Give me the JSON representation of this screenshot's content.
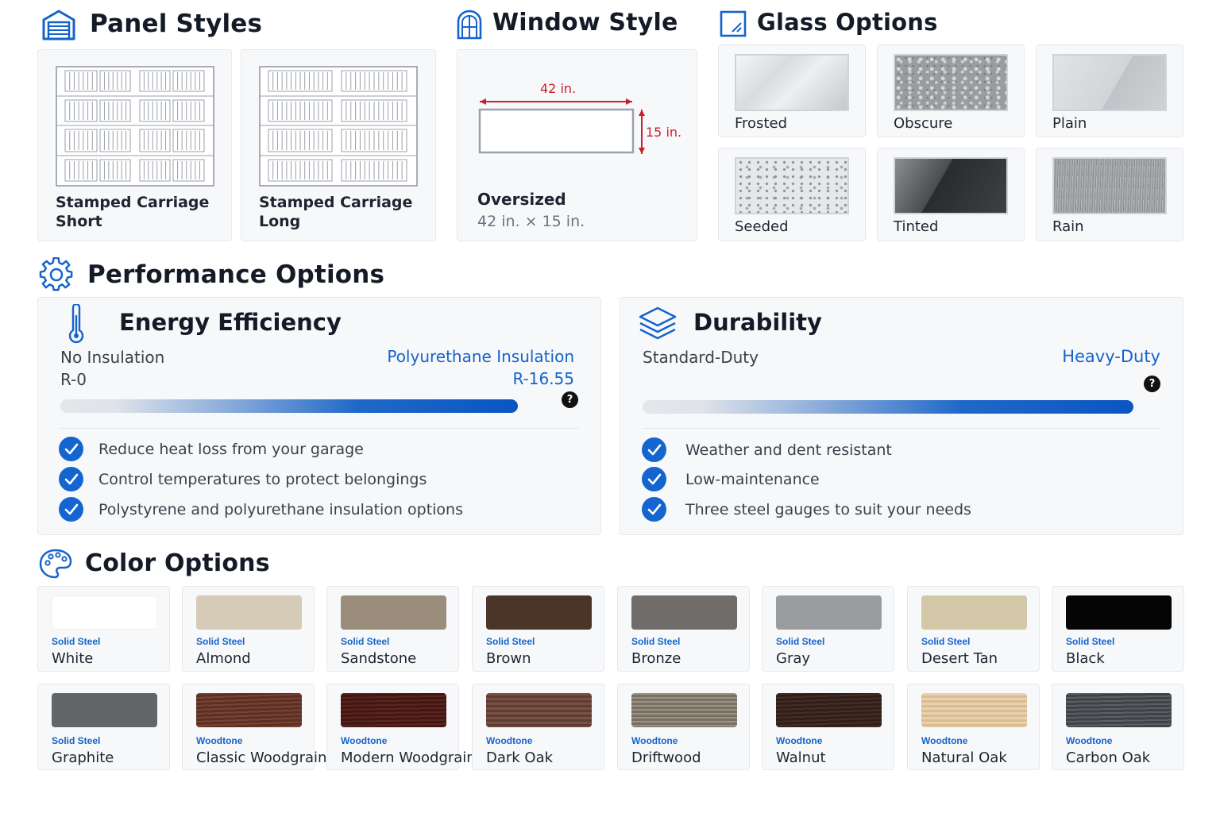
{
  "panel_styles": {
    "title": "Panel Styles",
    "items": [
      {
        "line1": "Stamped Carriage",
        "line2": "Short"
      },
      {
        "line1": "Stamped Carriage",
        "line2": "Long"
      }
    ]
  },
  "window_style": {
    "title": "Window Style",
    "width_dim": "42 in.",
    "height_dim": "15 in.",
    "name": "Oversized",
    "size": "42 in. × 15 in."
  },
  "glass_options": {
    "title": "Glass Options",
    "items": [
      {
        "label": "Frosted"
      },
      {
        "label": "Obscure"
      },
      {
        "label": "Plain"
      },
      {
        "label": "Seeded"
      },
      {
        "label": "Tinted"
      },
      {
        "label": "Rain"
      }
    ]
  },
  "performance": {
    "title": "Performance Options",
    "energy": {
      "title": "Energy Efficiency",
      "left_label": "No Insulation",
      "left_value": "R-0",
      "right_label": "Polyurethane Insulation",
      "right_value": "R-16.55",
      "help": "?",
      "features": [
        "Reduce heat loss from your garage",
        "Control temperatures to protect belongings",
        "Polystyrene and polyurethane insulation options"
      ]
    },
    "durability": {
      "title": "Durability",
      "left_label": "Standard-Duty",
      "right_label": "Heavy-Duty",
      "help": "?",
      "features": [
        "Weather and dent resistant",
        "Low-maintenance",
        "Three steel gauges to suit your needs"
      ]
    },
    "accent_color": "#1463cc"
  },
  "color_options": {
    "title": "Color Options",
    "items": [
      {
        "type": "Solid Steel",
        "name": "White",
        "color": "#ffffff"
      },
      {
        "type": "Solid Steel",
        "name": "Almond",
        "color": "#d6cbb6"
      },
      {
        "type": "Solid Steel",
        "name": "Sandstone",
        "color": "#9b8d7c"
      },
      {
        "type": "Solid Steel",
        "name": "Brown",
        "color": "#4a3528"
      },
      {
        "type": "Solid Steel",
        "name": "Bronze",
        "color": "#6f6c69"
      },
      {
        "type": "Solid Steel",
        "name": "Gray",
        "color": "#9b9c9e"
      },
      {
        "type": "Solid Steel",
        "name": "Desert Tan",
        "color": "#d2c7a6"
      },
      {
        "type": "Solid Steel",
        "name": "Black",
        "color": "#050505"
      },
      {
        "type": "Solid Steel",
        "name": "Graphite",
        "color": "#646568"
      },
      {
        "type": "Woodtone",
        "name": "Classic Woodgrain",
        "color": "#6a3526"
      },
      {
        "type": "Woodtone",
        "name": "Modern Woodgrain",
        "color": "#4e1a14"
      },
      {
        "type": "Woodtone",
        "name": "Dark Oak",
        "color": "#6b4335"
      },
      {
        "type": "Woodtone",
        "name": "Driftwood",
        "color": "#88806f"
      },
      {
        "type": "Woodtone",
        "name": "Walnut",
        "color": "#3a231c"
      },
      {
        "type": "Woodtone",
        "name": "Natural Oak",
        "color": "#e3c79e"
      },
      {
        "type": "Woodtone",
        "name": "Carbon Oak",
        "color": "#4a4d53"
      }
    ]
  }
}
